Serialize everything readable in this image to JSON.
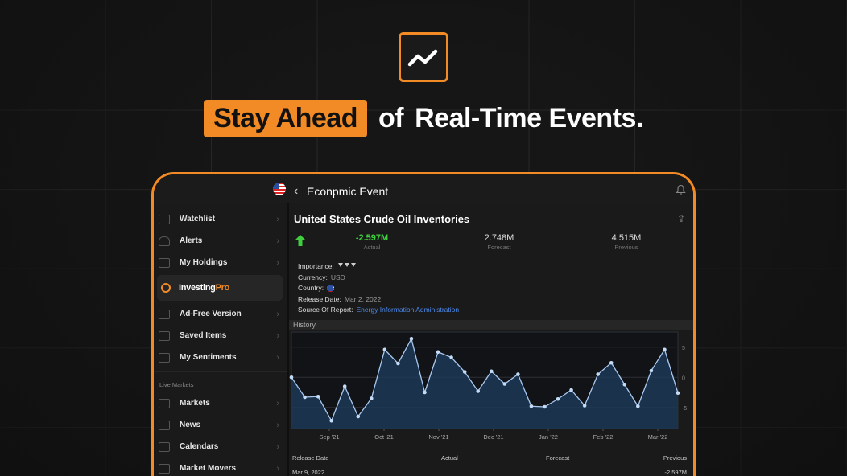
{
  "headline": {
    "highlight": "Stay Ahead",
    "rest_a": "of",
    "rest_b": "Real-Time Events."
  },
  "nav": {
    "title": "Econpmic Event"
  },
  "sidebar": {
    "items": [
      {
        "label": "Watchlist"
      },
      {
        "label": "Alerts"
      },
      {
        "label": "My Holdings"
      }
    ],
    "pro": {
      "a": "Investing",
      "b": "Pro"
    },
    "items2": [
      {
        "label": "Ad-Free Version"
      },
      {
        "label": "Saved Items"
      },
      {
        "label": "My Sentiments"
      }
    ],
    "section": "Live Markets",
    "items3": [
      {
        "label": "Markets"
      },
      {
        "label": "News"
      },
      {
        "label": "Calendars"
      },
      {
        "label": "Market Movers"
      }
    ]
  },
  "event": {
    "title": "United States Crude Oil Inventories",
    "actual": {
      "value": "-2.597M",
      "label": "Actual"
    },
    "forecast": {
      "value": "2.748M",
      "label": "Forecast"
    },
    "previous": {
      "value": "4.515M",
      "label": "Previous"
    },
    "importance_label": "Importance:",
    "currency_label": "Currency:",
    "currency": "USD",
    "country_label": "Country:",
    "release_label": "Release Date:",
    "release_date": "Mar 2, 2022",
    "source_label": "Source Of Report:",
    "source": "Energy Information Administration"
  },
  "history_label": "History",
  "table": {
    "headers": [
      "Release Date",
      "Actual",
      "Forecast",
      "Previous"
    ],
    "rows": [
      {
        "date": "Mar 9, 2022",
        "actual": "",
        "forecast": "",
        "previous": "-2.597M"
      }
    ]
  },
  "colors": {
    "accent": "#f28b25",
    "positive": "#3fcf3f",
    "link": "#4d8bf0",
    "line": "#a9c9f1"
  },
  "chart_data": {
    "type": "area",
    "xlabel": "",
    "ylabel": "",
    "x_ticks": [
      "Sep '21",
      "Oct '21",
      "Nov '21",
      "Dec '21",
      "Jan '22",
      "Feb '22",
      "Mar '22"
    ],
    "y_ticks": [
      5,
      0,
      -5
    ],
    "ylim": [
      -8.5,
      7.5
    ],
    "series": [
      {
        "values": [
          0,
          -3.3,
          -3.2,
          -7.2,
          -1.5,
          -6.5,
          -3.5,
          4.6,
          2.3,
          6.4,
          -2.5,
          4.2,
          3.3,
          0.9,
          -2.3,
          1.0,
          -1.1,
          0.5,
          -4.8,
          -4.9,
          -3.6,
          -2.1,
          -4.7,
          0.5,
          2.4,
          -1.2,
          -4.8,
          1.1,
          4.6,
          -2.6
        ]
      }
    ]
  }
}
